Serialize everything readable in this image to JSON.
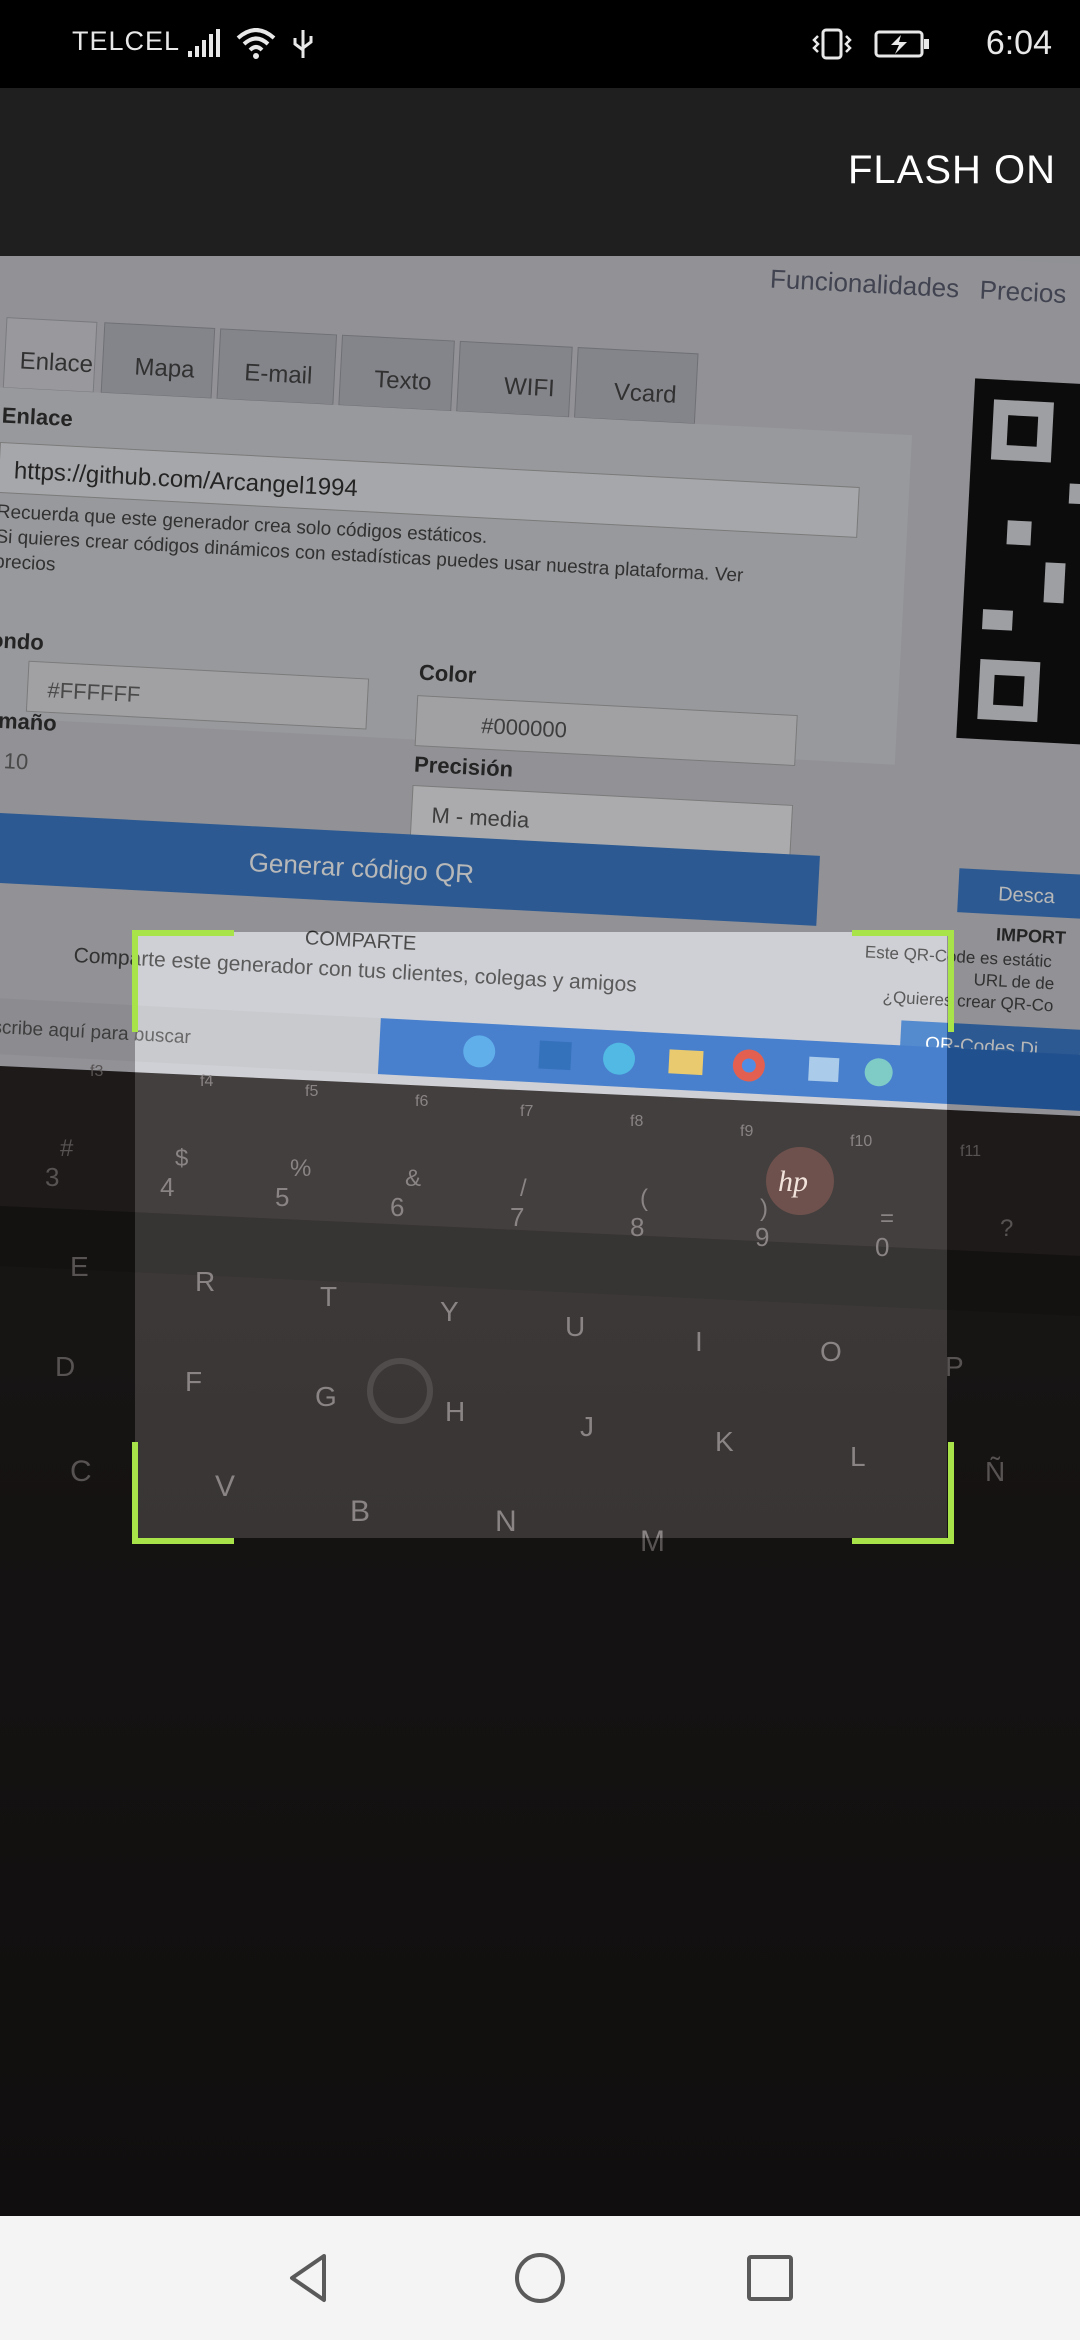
{
  "status_bar": {
    "carrier": "TELCEL",
    "time": "6:04",
    "icons": [
      "signal-icon",
      "wifi-icon",
      "usb-icon",
      "vibrate-icon",
      "battery-charging-icon"
    ]
  },
  "app_bar": {
    "flash_label": "FLASH ON"
  },
  "camera_preview": {
    "scene_text": {
      "nav_links": [
        "Funcionalidades",
        "Precios"
      ],
      "tabs": [
        "Enlace",
        "Mapa",
        "E-mail",
        "Texto",
        "WIFI",
        "Vcard"
      ],
      "section_label": "Enlace",
      "url_value": "https://github.com/Arcangel1994",
      "note_line1": "Recuerda que este generador crea solo códigos estáticos.",
      "note_line2": "Si quieres crear códigos dinámicos con estadísticas puedes usar nuestra plataforma. Ver",
      "note_line3": "precios",
      "fondo_label": "ondo",
      "fondo_value": "#FFFFFF",
      "color_label": "Color",
      "color_value": "#000000",
      "tamano_label": "amaño",
      "tamano_value": "10",
      "precision_label": "Precisión",
      "precision_value": "M - media",
      "generate_button": "Generar código QR",
      "share_title": "COMPARTE",
      "share_text": "Comparte este generador con tus clientes, colegas y amigos",
      "search_text": "Escribe aquí para buscar",
      "download_button": "Desca",
      "import_title": "IMPORT",
      "import_line1": "Este QR-Code es estátic",
      "import_line2": "URL de de",
      "import_line3": "¿Quieres crear QR-Co",
      "qr_codes_button": "QR-Codes Di",
      "laptop_brand": "hp",
      "keys_row_fn": [
        "f3",
        "f4",
        "f5",
        "f6",
        "f7",
        "f8",
        "f9",
        "f10",
        "f11"
      ],
      "keys_row_num_top": [
        "#",
        "$",
        "%",
        "&",
        "/",
        "(",
        ")",
        "=",
        "?"
      ],
      "keys_row_num": [
        "3",
        "4",
        "5",
        "6",
        "7",
        "8",
        "9",
        "0"
      ],
      "keys_row_q": [
        "E",
        "R",
        "T",
        "Y",
        "U",
        "I",
        "O",
        "P"
      ],
      "keys_row_a": [
        "D",
        "F",
        "G",
        "H",
        "J",
        "K",
        "L",
        "Ñ"
      ],
      "keys_row_z": [
        "C",
        "V",
        "B",
        "N",
        "M"
      ]
    }
  },
  "nav_bar": {
    "buttons": [
      "back",
      "home",
      "recent-apps"
    ]
  }
}
